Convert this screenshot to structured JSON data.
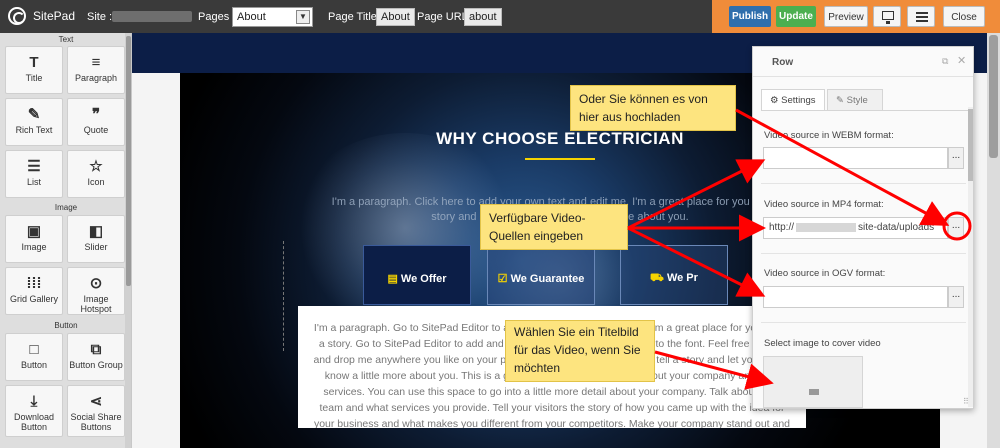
{
  "topbar": {
    "logo_text": "SitePad",
    "site_label": "Site :",
    "pages_label": "Pages :",
    "pages_selected": "About",
    "page_title_label": "Page Title:",
    "page_title_value": "About",
    "page_url_label": "Page URL:",
    "page_url_value": "about",
    "publish": "Publish",
    "update": "Update",
    "preview": "Preview",
    "close": "Close",
    "icons": [
      "monitor-icon",
      "menu-icon"
    ]
  },
  "sidebar": {
    "sections": [
      "Text",
      "Image",
      "Button"
    ],
    "widgets": [
      {
        "label": "Title",
        "icon": "T"
      },
      {
        "label": "Paragraph",
        "icon": "≡"
      },
      {
        "label": "Rich Text",
        "icon": "✎"
      },
      {
        "label": "Quote",
        "icon": "❞"
      },
      {
        "label": "List",
        "icon": "☰"
      },
      {
        "label": "Icon",
        "icon": "☆"
      },
      {
        "label": "Image",
        "icon": "▣"
      },
      {
        "label": "Slider",
        "icon": "◧"
      },
      {
        "label": "Grid Gallery",
        "icon": "⁞⁞⁞"
      },
      {
        "label": "Image Hotspot",
        "icon": "⊙"
      },
      {
        "label": "Button",
        "icon": "□"
      },
      {
        "label": "Button Group",
        "icon": "⧉"
      },
      {
        "label": "Download Button",
        "icon": "⤓"
      },
      {
        "label": "Social Share Buttons",
        "icon": "⋖"
      }
    ]
  },
  "hero": {
    "title": "WHY CHOOSE ELECTRICIAN",
    "paragraph": "I'm a paragraph. Click here to add your own text and edit me. I'm a great place for you to tell a story and let your users know a little more about you.",
    "tabs": [
      {
        "icon": "▤",
        "label": "We Offer"
      },
      {
        "icon": "☑",
        "label": "We Guarantee"
      },
      {
        "icon": "⛟",
        "label": "We Pr"
      }
    ],
    "content": "I'm a paragraph. Go to SitePad Editor to add your own text and edit me. I'm a great place for you to tell a story. Go to SitePad Editor to add and edit content and make changes to the font. Feel free to drag and drop me anywhere you like on your page. I'm a great place for you to tell a story and let your users know a little more about you. This is a great space to write long text about your company and your services. You can use this space to go into a little more detail about your company. Talk about your team and what services you provide. Tell your visitors the story of how you came up with the idea for your business and what makes you different from your competitors. Make your company stand out and show your visitors who you are."
  },
  "panel": {
    "title": "Row",
    "tab_settings": "Settings",
    "tab_style": "Style",
    "webm_label": "Video source in WEBM format:",
    "webm_value": "",
    "mp4_label": "Video source in MP4 format:",
    "mp4_prefix": "http://",
    "mp4_suffix": "site-data/uploads",
    "ogv_label": "Video source in OGV format:",
    "ogv_value": "",
    "cover_label": "Select image to cover video",
    "more_btn": "..."
  },
  "annotations": {
    "note_upload": "Oder Sie können es von hier aus hochladen",
    "note_sources": "Verfügbare Video-Quellen eingeben",
    "note_cover": "Wählen Sie ein Titelbild für das Video, wenn Sie möchten",
    "arrow_color": "#ff0000",
    "note_color": "#fde47f"
  }
}
